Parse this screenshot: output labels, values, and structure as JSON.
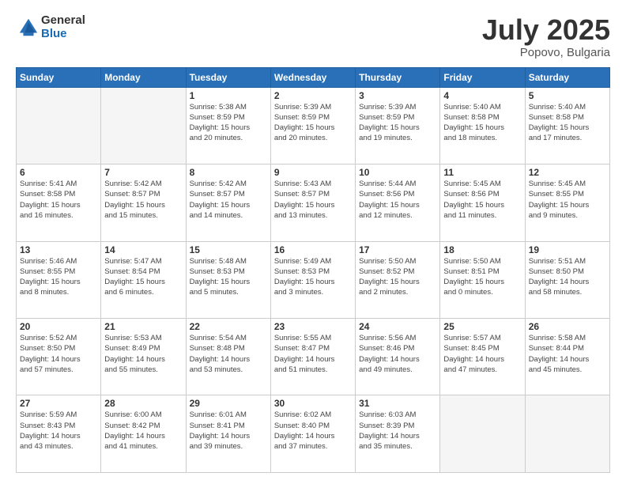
{
  "logo": {
    "general": "General",
    "blue": "Blue"
  },
  "title": "July 2025",
  "location": "Popovo, Bulgaria",
  "headers": [
    "Sunday",
    "Monday",
    "Tuesday",
    "Wednesday",
    "Thursday",
    "Friday",
    "Saturday"
  ],
  "weeks": [
    [
      {
        "day": "",
        "info": ""
      },
      {
        "day": "",
        "info": ""
      },
      {
        "day": "1",
        "info": "Sunrise: 5:38 AM\nSunset: 8:59 PM\nDaylight: 15 hours\nand 20 minutes."
      },
      {
        "day": "2",
        "info": "Sunrise: 5:39 AM\nSunset: 8:59 PM\nDaylight: 15 hours\nand 20 minutes."
      },
      {
        "day": "3",
        "info": "Sunrise: 5:39 AM\nSunset: 8:59 PM\nDaylight: 15 hours\nand 19 minutes."
      },
      {
        "day": "4",
        "info": "Sunrise: 5:40 AM\nSunset: 8:58 PM\nDaylight: 15 hours\nand 18 minutes."
      },
      {
        "day": "5",
        "info": "Sunrise: 5:40 AM\nSunset: 8:58 PM\nDaylight: 15 hours\nand 17 minutes."
      }
    ],
    [
      {
        "day": "6",
        "info": "Sunrise: 5:41 AM\nSunset: 8:58 PM\nDaylight: 15 hours\nand 16 minutes."
      },
      {
        "day": "7",
        "info": "Sunrise: 5:42 AM\nSunset: 8:57 PM\nDaylight: 15 hours\nand 15 minutes."
      },
      {
        "day": "8",
        "info": "Sunrise: 5:42 AM\nSunset: 8:57 PM\nDaylight: 15 hours\nand 14 minutes."
      },
      {
        "day": "9",
        "info": "Sunrise: 5:43 AM\nSunset: 8:57 PM\nDaylight: 15 hours\nand 13 minutes."
      },
      {
        "day": "10",
        "info": "Sunrise: 5:44 AM\nSunset: 8:56 PM\nDaylight: 15 hours\nand 12 minutes."
      },
      {
        "day": "11",
        "info": "Sunrise: 5:45 AM\nSunset: 8:56 PM\nDaylight: 15 hours\nand 11 minutes."
      },
      {
        "day": "12",
        "info": "Sunrise: 5:45 AM\nSunset: 8:55 PM\nDaylight: 15 hours\nand 9 minutes."
      }
    ],
    [
      {
        "day": "13",
        "info": "Sunrise: 5:46 AM\nSunset: 8:55 PM\nDaylight: 15 hours\nand 8 minutes."
      },
      {
        "day": "14",
        "info": "Sunrise: 5:47 AM\nSunset: 8:54 PM\nDaylight: 15 hours\nand 6 minutes."
      },
      {
        "day": "15",
        "info": "Sunrise: 5:48 AM\nSunset: 8:53 PM\nDaylight: 15 hours\nand 5 minutes."
      },
      {
        "day": "16",
        "info": "Sunrise: 5:49 AM\nSunset: 8:53 PM\nDaylight: 15 hours\nand 3 minutes."
      },
      {
        "day": "17",
        "info": "Sunrise: 5:50 AM\nSunset: 8:52 PM\nDaylight: 15 hours\nand 2 minutes."
      },
      {
        "day": "18",
        "info": "Sunrise: 5:50 AM\nSunset: 8:51 PM\nDaylight: 15 hours\nand 0 minutes."
      },
      {
        "day": "19",
        "info": "Sunrise: 5:51 AM\nSunset: 8:50 PM\nDaylight: 14 hours\nand 58 minutes."
      }
    ],
    [
      {
        "day": "20",
        "info": "Sunrise: 5:52 AM\nSunset: 8:50 PM\nDaylight: 14 hours\nand 57 minutes."
      },
      {
        "day": "21",
        "info": "Sunrise: 5:53 AM\nSunset: 8:49 PM\nDaylight: 14 hours\nand 55 minutes."
      },
      {
        "day": "22",
        "info": "Sunrise: 5:54 AM\nSunset: 8:48 PM\nDaylight: 14 hours\nand 53 minutes."
      },
      {
        "day": "23",
        "info": "Sunrise: 5:55 AM\nSunset: 8:47 PM\nDaylight: 14 hours\nand 51 minutes."
      },
      {
        "day": "24",
        "info": "Sunrise: 5:56 AM\nSunset: 8:46 PM\nDaylight: 14 hours\nand 49 minutes."
      },
      {
        "day": "25",
        "info": "Sunrise: 5:57 AM\nSunset: 8:45 PM\nDaylight: 14 hours\nand 47 minutes."
      },
      {
        "day": "26",
        "info": "Sunrise: 5:58 AM\nSunset: 8:44 PM\nDaylight: 14 hours\nand 45 minutes."
      }
    ],
    [
      {
        "day": "27",
        "info": "Sunrise: 5:59 AM\nSunset: 8:43 PM\nDaylight: 14 hours\nand 43 minutes."
      },
      {
        "day": "28",
        "info": "Sunrise: 6:00 AM\nSunset: 8:42 PM\nDaylight: 14 hours\nand 41 minutes."
      },
      {
        "day": "29",
        "info": "Sunrise: 6:01 AM\nSunset: 8:41 PM\nDaylight: 14 hours\nand 39 minutes."
      },
      {
        "day": "30",
        "info": "Sunrise: 6:02 AM\nSunset: 8:40 PM\nDaylight: 14 hours\nand 37 minutes."
      },
      {
        "day": "31",
        "info": "Sunrise: 6:03 AM\nSunset: 8:39 PM\nDaylight: 14 hours\nand 35 minutes."
      },
      {
        "day": "",
        "info": ""
      },
      {
        "day": "",
        "info": ""
      }
    ]
  ]
}
